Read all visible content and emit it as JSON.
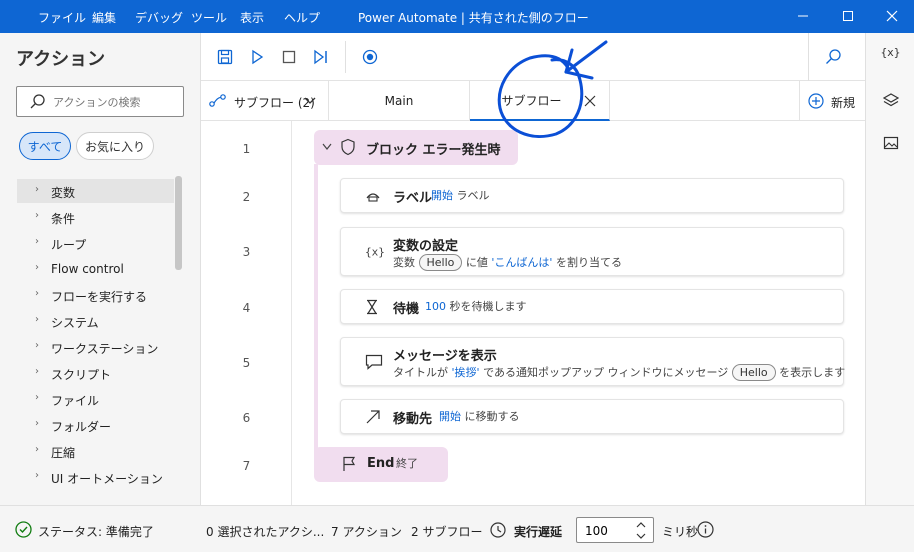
{
  "menu": [
    "ファイル",
    "編集",
    "デバッグ",
    "ツール",
    "表示",
    "ヘルプ"
  ],
  "window_title": "Power Automate | 共有された側のフロー",
  "left_panel": {
    "title": "アクション",
    "search_placeholder": "アクションの検索",
    "chips": {
      "all": "すべて",
      "favorites": "お気に入り"
    },
    "categories": [
      "変数",
      "条件",
      "ループ",
      "Flow control",
      "フローを実行する",
      "システム",
      "ワークステーション",
      "スクリプト",
      "ファイル",
      "フォルダー",
      "圧縮",
      "UI オートメーション"
    ]
  },
  "subflows_dropdown": "サブフロー (2)",
  "tabs": {
    "main": "Main",
    "subflow": "サブフロー"
  },
  "new_button": "新規",
  "line_numbers": [
    "1",
    "2",
    "3",
    "4",
    "5",
    "6",
    "7"
  ],
  "block": {
    "header": "ブロック エラー発生時",
    "end_keyword": "End",
    "end_text": "終了"
  },
  "actions": [
    {
      "title": "ラベル",
      "desc": {
        "kw": "開始",
        "tail": "ラベル"
      }
    },
    {
      "title": "変数の設定",
      "desc": {
        "prefix": "変数",
        "var": "Hello",
        "mid": "に値",
        "value": "'こんばんは'",
        "tail": "を割り当てる"
      }
    },
    {
      "title": "待機",
      "desc": {
        "kw": "100",
        "tail": "秒を待機します"
      }
    },
    {
      "title": "メッセージを表示",
      "desc": {
        "prefix": "タイトルが",
        "kw": "'挨拶'",
        "mid": "である通知ポップアップ ウィンドウにメッセージ",
        "var": "Hello",
        "tail": "を表示します"
      }
    },
    {
      "title": "移動先",
      "desc": {
        "kw": "開始",
        "tail": "に移動する"
      }
    }
  ],
  "right_panel": {
    "variables_label": "{x}"
  },
  "status": {
    "state": "ステータス: 準備完了",
    "selected": "0 選択されたアクシ...",
    "actions": "7 アクション",
    "subflows": "2 サブフロー",
    "delay_label": "実行遅延",
    "delay_value": "100",
    "unit": "ミリ秒"
  },
  "colors": {
    "accent": "#0e66d3",
    "block": "#f1ddef",
    "ink": "#0b4fd6"
  }
}
